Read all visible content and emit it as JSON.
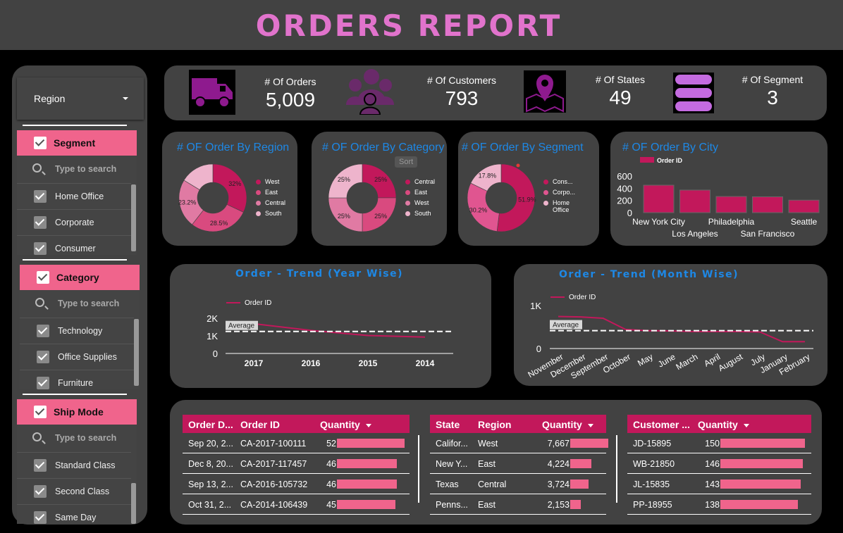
{
  "header": {
    "title": "ORDERS REPORT"
  },
  "sidebar": {
    "region": {
      "label": "Region"
    },
    "segment": {
      "label": "Segment",
      "search": "Type to search",
      "options": [
        "Home Office",
        "Corporate",
        "Consumer"
      ]
    },
    "category": {
      "label": "Category",
      "search": "Type to search",
      "options": [
        "Technology",
        "Office Supplies",
        "Furniture"
      ]
    },
    "ship_mode": {
      "label": "Ship Mode",
      "search": "Type to search",
      "options": [
        "Standard Class",
        "Second Class",
        "Same Day"
      ]
    }
  },
  "kpis": [
    {
      "label": "# Of Orders",
      "value": "5,009",
      "icon": "truck-icon"
    },
    {
      "label": "# Of Customers",
      "value": "793",
      "icon": "users-icon"
    },
    {
      "label": "# Of States",
      "value": "49",
      "icon": "map-pin-icon"
    },
    {
      "label": "# Of Segment",
      "value": "3",
      "icon": "database-icon"
    }
  ],
  "colors": {
    "accent": "#c2185b",
    "pink": "#f0648c",
    "title_blue": "#1e88e5",
    "header_pink": "#e173cc",
    "panel": "#424242"
  },
  "charts": {
    "region": {
      "title": "# OF Order By Region",
      "chart_data": {
        "type": "pie",
        "categories": [
          "West",
          "East",
          "Central",
          "South"
        ],
        "values": [
          32,
          28.5,
          23.2,
          16.3
        ],
        "labels": [
          "32%",
          "28.5%",
          "23.2%",
          ""
        ],
        "colors": [
          "#c2185b",
          "#d94a7f",
          "#e07aa3",
          "#eeb4cc"
        ]
      }
    },
    "category": {
      "title": "# OF Order By Category",
      "sort_label": "Sort",
      "chart_data": {
        "type": "pie",
        "categories": [
          "Central",
          "East",
          "West",
          "South"
        ],
        "values": [
          25,
          25,
          25,
          25
        ],
        "labels": [
          "25%",
          "25%",
          "25%",
          "25%"
        ],
        "colors": [
          "#c2185b",
          "#d94a7f",
          "#e07aa3",
          "#eeb4cc"
        ]
      }
    },
    "segment": {
      "title": "# OF Order By Segment",
      "chart_data": {
        "type": "pie",
        "categories": [
          "Cons...",
          "Corpo...",
          "Home Office"
        ],
        "values": [
          51.9,
          30.2,
          17.8
        ],
        "labels": [
          "51.9%",
          "30.2%",
          "17.8%"
        ],
        "colors": [
          "#c2185b",
          "#e05590",
          "#eeb4cc"
        ]
      }
    },
    "city": {
      "title": "# OF Order By City",
      "chart_data": {
        "type": "bar",
        "legend": "Order ID",
        "categories": [
          "New York City",
          "Los Angeles",
          "Philadelphia",
          "San Francisco",
          "Seattle"
        ],
        "values": [
          450,
          370,
          265,
          260,
          205
        ],
        "yticks": [
          "600",
          "400",
          "200",
          "0"
        ],
        "ylim": [
          0,
          600
        ]
      }
    },
    "year_trend": {
      "title": "Order - Trend (Year Wise)",
      "chart_data": {
        "type": "line",
        "legend": "Order ID",
        "categories": [
          "2017",
          "2016",
          "2015",
          "2014"
        ],
        "values": [
          1690,
          1310,
          1020,
          930
        ],
        "average": 1252,
        "average_label": "Average",
        "yticks": [
          "2K",
          "1K",
          "0"
        ],
        "ylim": [
          0,
          2000
        ]
      }
    },
    "month_trend": {
      "title": "Order - Trend (Month Wise)",
      "chart_data": {
        "type": "line",
        "legend": "Order ID",
        "categories": [
          "November",
          "December",
          "September",
          "October",
          "May",
          "June",
          "March",
          "April",
          "August",
          "July",
          "January",
          "February"
        ],
        "values": [
          745,
          735,
          705,
          445,
          415,
          410,
          395,
          395,
          395,
          385,
          160,
          160
        ],
        "average": 417,
        "average_label": "Average",
        "yticks": [
          "1K",
          "0"
        ],
        "ylim": [
          0,
          1000
        ]
      }
    }
  },
  "tables": {
    "orders": {
      "headers": [
        "Order D...",
        "Order ID",
        "Quantity"
      ],
      "rows": [
        {
          "a": "Sep 20, 2...",
          "b": "CA-2017-100111",
          "q": "52",
          "qv": 52
        },
        {
          "a": "Dec 8, 20...",
          "b": "CA-2017-117457",
          "q": "46",
          "qv": 46
        },
        {
          "a": "Sep 13, 2...",
          "b": "CA-2016-105732",
          "q": "46",
          "qv": 46
        },
        {
          "a": "Oct 31, 2...",
          "b": "CA-2014-106439",
          "q": "45",
          "qv": 45
        }
      ]
    },
    "states": {
      "headers": [
        "State",
        "Region",
        "Quantity"
      ],
      "rows": [
        {
          "a": "Califor...",
          "b": "West",
          "q": "7,667",
          "qv": 7667
        },
        {
          "a": "New Y...",
          "b": "East",
          "q": "4,224",
          "qv": 4224
        },
        {
          "a": "Texas",
          "b": "Central",
          "q": "3,724",
          "qv": 3724
        },
        {
          "a": "Penns...",
          "b": "East",
          "q": "2,153",
          "qv": 2153
        }
      ]
    },
    "customers": {
      "headers": [
        "Customer ...",
        "Quantity"
      ],
      "rows": [
        {
          "a": "JD-15895",
          "q": "150",
          "qv": 150
        },
        {
          "a": "WB-21850",
          "q": "146",
          "qv": 146
        },
        {
          "a": "JL-15835",
          "q": "143",
          "qv": 143
        },
        {
          "a": "PP-18955",
          "q": "138",
          "qv": 138
        }
      ]
    }
  }
}
